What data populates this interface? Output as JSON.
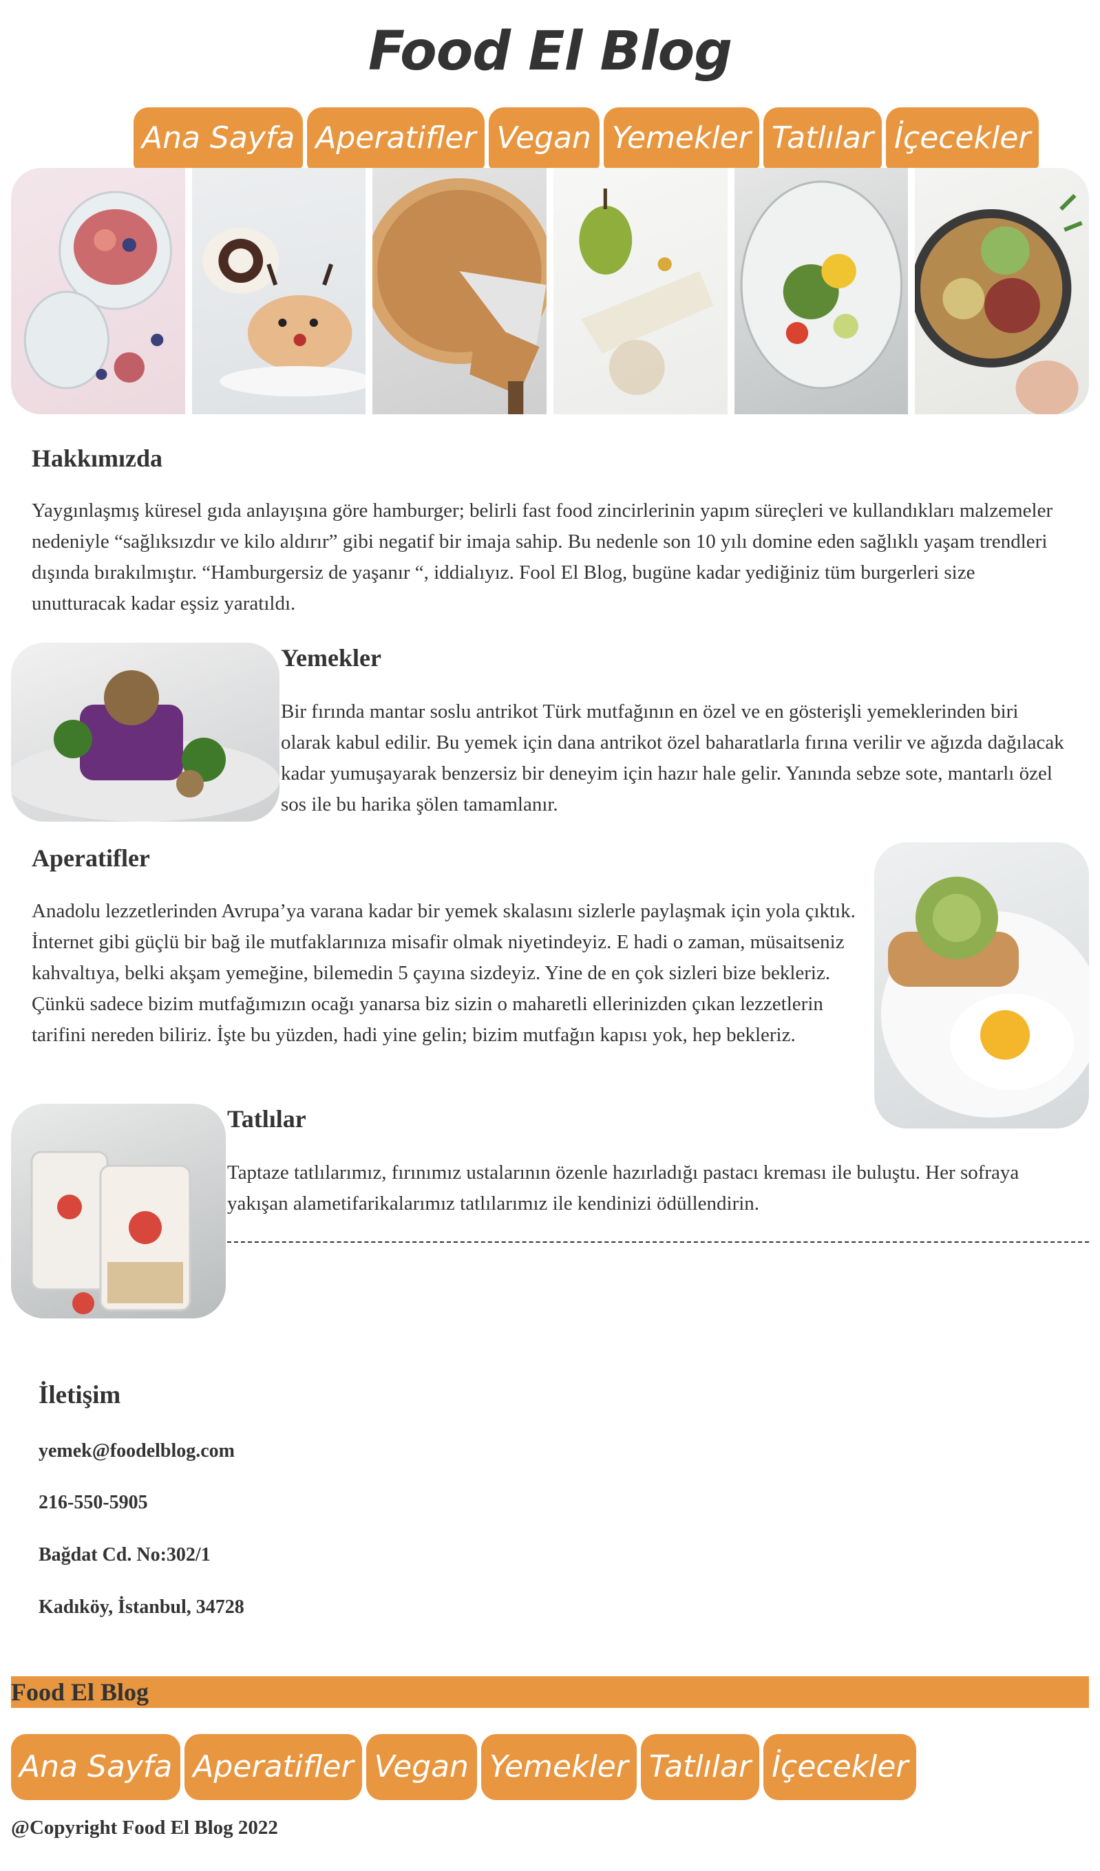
{
  "site": {
    "title": "Food El Blog"
  },
  "nav": [
    "Ana Sayfa",
    "Aperatifler",
    "Vegan",
    "Yemekler",
    "Tatlılar",
    "İçecekler"
  ],
  "sections": {
    "about": {
      "title": "Hakkımızda",
      "text": "Yaygınlaşmış küresel gıda anlayışına göre hamburger; belirli fast food zincirlerinin yapım süreçleri ve kullandıkları malzemeler nedeniyle “sağlıksızdır ve kilo aldırır” gibi negatif bir imaja sahip. Bu nedenle son 10 yılı domine eden sağlıklı yaşam trendleri dışında bırakılmıştır. “Hamburgersiz de yaşanır “, iddialıyız. Fool El Blog, bugüne kadar yediğiniz tüm burgerleri size unutturacak kadar eşsiz yaratıldı."
    },
    "yemekler": {
      "title": "Yemekler",
      "text": "Bir fırında mantar soslu antrikot Türk mutfağının en özel ve en gösterişli yemeklerinden biri olarak kabul edilir. Bu yemek için dana antrikot özel baharatlarla fırına verilir ve ağızda dağılacak kadar yumuşayarak benzersiz bir deneyim için hazır hale gelir. Yanında sebze sote, mantarlı özel sos ile bu harika şölen tamamlanır."
    },
    "aperatifler": {
      "title": "Aperatifler",
      "text": "Anadolu lezzetlerinden Avrupa’ya varana kadar bir yemek skalasını sizlerle paylaşmak için yola çıktık. İnternet gibi güçlü bir bağ ile mutfaklarınıza misafir olmak niyetindeyiz. E hadi o zaman, müsaitseniz kahvaltıya, belki akşam yemeğine, bilemedin 5 çayına sizdeyiz. Yine de en çok sizleri bize bekleriz. Çünkü sadece bizim mutfağımızın ocağı yanarsa biz sizin o maharetli ellerinizden çıkan lezzetlerin tarifini nereden biliriz. İşte bu yüzden, hadi yine gelin; bizim mutfağın kapısı yok, hep bekleriz."
    },
    "tatlilar": {
      "title": "Tatlılar",
      "text": "Taptaze tatlılarımız, fırınımız ustalarının özenle hazırladığı pastacı kreması ile buluştu. Her sofraya yakışan alametifarikalarımız tatlılarımız ile kendinizi ödüllendirin."
    }
  },
  "contact": {
    "title": "İletişim",
    "email": "yemek@foodelblog.com",
    "phone": "216-550-5905",
    "address1": "Bağdat Cd. No:302/1",
    "address2": "Kadıköy, İstanbul, 34728"
  },
  "footer": {
    "brand": "Food El Blog",
    "copyright": "@Copyright Food El Blog 2022"
  },
  "colors": {
    "accent": "#e8963f",
    "text": "#333333"
  }
}
